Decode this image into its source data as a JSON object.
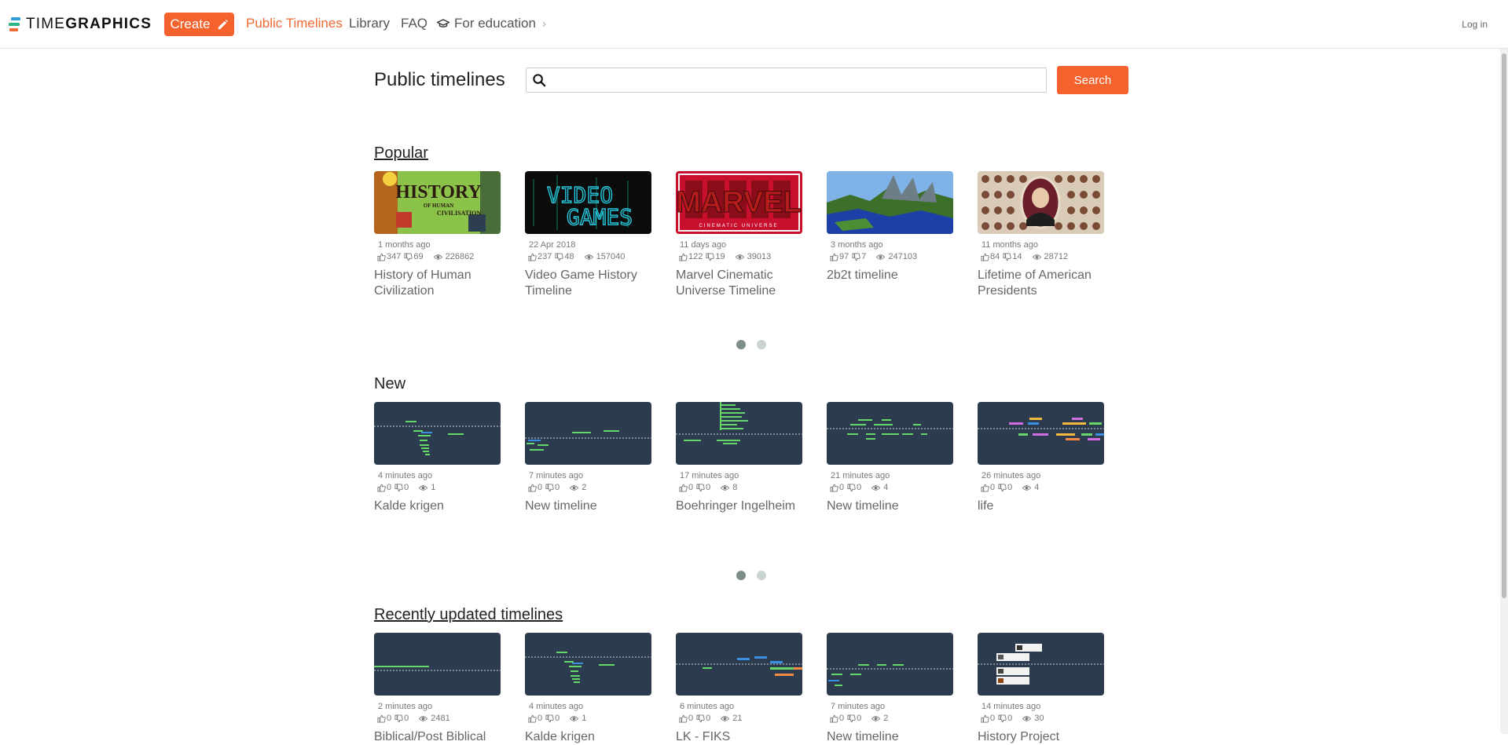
{
  "header": {
    "logo_text_a": "TIME",
    "logo_text_b": "GRAPHICS",
    "create_label": "Create",
    "nav": {
      "public": "Public Timelines",
      "library": "Library",
      "faq": "FAQ",
      "education": "For education"
    },
    "login": "Log in"
  },
  "search": {
    "title": "Public timelines",
    "placeholder": "",
    "button": "Search"
  },
  "sections": {
    "popular": {
      "title": "Popular",
      "cards": [
        {
          "date": "1 months ago",
          "likes": "347",
          "dislikes": "69",
          "views": "226862",
          "title_1": "History of Human",
          "title_2": "Civilization",
          "thumb_text_a": "HISTORY",
          "thumb_text_b": "OF HUMAN",
          "thumb_text_c": "CIVILISATION"
        },
        {
          "date": "22 Apr 2018",
          "likes": "237",
          "dislikes": "48",
          "views": "157040",
          "title_1": "Video Game History",
          "title_2": "Timeline",
          "thumb_text_a": "VIDEO",
          "thumb_text_b": "GAMES"
        },
        {
          "date": "11 days ago",
          "likes": "122",
          "dislikes": "19",
          "views": "39013",
          "title_1": "Marvel Cinematic",
          "title_2": "Universe Timeline",
          "thumb_text_a": "MARVEL",
          "thumb_text_b": "CINEMATIC UNIVERSE"
        },
        {
          "date": "3 months ago",
          "likes": "97",
          "dislikes": "7",
          "views": "247103",
          "title_1": "2b2t timeline",
          "title_2": ""
        },
        {
          "date": "11 months ago",
          "likes": "84",
          "dislikes": "14",
          "views": "28712",
          "title_1": "Lifetime of American",
          "title_2": "Presidents"
        }
      ]
    },
    "new": {
      "title": "New",
      "cards": [
        {
          "date": "4 minutes ago",
          "likes": "0",
          "dislikes": "0",
          "views": "1",
          "title_1": "Kalde krigen",
          "title_2": ""
        },
        {
          "date": "7 minutes ago",
          "likes": "0",
          "dislikes": "0",
          "views": "2",
          "title_1": "New timeline",
          "title_2": ""
        },
        {
          "date": "17 minutes ago",
          "likes": "0",
          "dislikes": "0",
          "views": "8",
          "title_1": "Boehringer Ingelheim",
          "title_2": ""
        },
        {
          "date": "21 minutes ago",
          "likes": "0",
          "dislikes": "0",
          "views": "4",
          "title_1": "New timeline",
          "title_2": ""
        },
        {
          "date": "26 minutes ago",
          "likes": "0",
          "dislikes": "0",
          "views": "4",
          "title_1": "life",
          "title_2": ""
        }
      ]
    },
    "recent": {
      "title": "Recently updated timelines",
      "cards": [
        {
          "date": "2 minutes ago",
          "likes": "0",
          "dislikes": "0",
          "views": "2481",
          "title_1": "Biblical/Post Biblical",
          "title_2": ""
        },
        {
          "date": "4 minutes ago",
          "likes": "0",
          "dislikes": "0",
          "views": "1",
          "title_1": "Kalde krigen",
          "title_2": ""
        },
        {
          "date": "6 minutes ago",
          "likes": "0",
          "dislikes": "0",
          "views": "21",
          "title_1": "LK - FIKS",
          "title_2": ""
        },
        {
          "date": "7 minutes ago",
          "likes": "0",
          "dislikes": "0",
          "views": "2",
          "title_1": "New timeline",
          "title_2": ""
        },
        {
          "date": "14 minutes ago",
          "likes": "0",
          "dislikes": "0",
          "views": "30",
          "title_1": "History Project",
          "title_2": ""
        }
      ]
    }
  },
  "colors": {
    "accent": "#f5622d",
    "timeline_bg": "#2d3b4e",
    "dot_active": "#7d8e89",
    "dot_inactive": "#c9d3cf"
  },
  "icons": [
    "pencil-icon",
    "graduation-cap-icon",
    "search-icon",
    "thumbs-up-icon",
    "thumbs-down-icon",
    "eye-icon"
  ]
}
